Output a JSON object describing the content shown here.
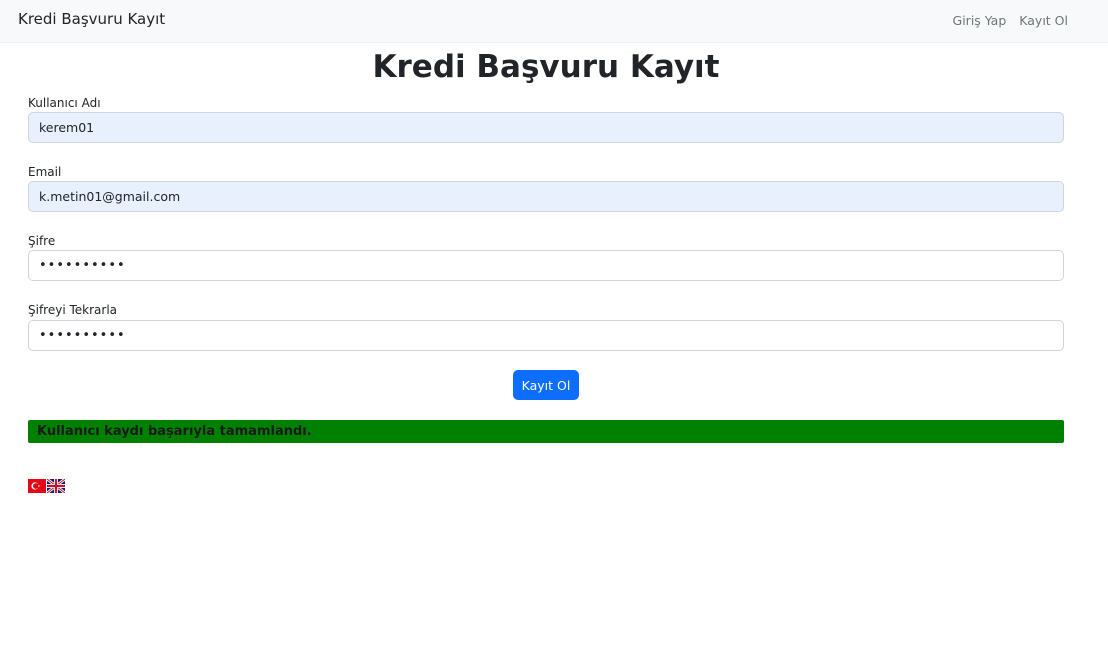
{
  "navbar": {
    "brand": "Kredi Başvuru Kayıt",
    "links": [
      {
        "label": "Giriş Yap"
      },
      {
        "label": "Kayıt Ol"
      }
    ]
  },
  "page": {
    "title": "Kredi Başvuru Kayıt"
  },
  "form": {
    "username": {
      "label": "Kullanıcı Adı",
      "value": "kerem01"
    },
    "email": {
      "label": "Email",
      "value": "k.metin01@gmail.com"
    },
    "password": {
      "label": "Şifre",
      "value": "••••••••••"
    },
    "password_repeat": {
      "label": "Şifreyi Tekrarla",
      "value": "••••••••••"
    },
    "submit_label": "Kayıt Ol"
  },
  "alert": {
    "message": "Kullanıcı kaydı başarıyla tamamlandı.",
    "color": "#008000"
  },
  "languages": [
    {
      "icon": "turkey-flag-icon"
    },
    {
      "icon": "uk-flag-icon"
    }
  ],
  "colors": {
    "primary": "#0d6efd",
    "autofill_bg": "#e8f0fe",
    "navbar_bg": "#f8f9fa"
  }
}
